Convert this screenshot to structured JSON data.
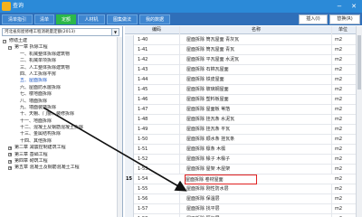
{
  "window": {
    "title": "查询",
    "minimize": "−",
    "close": "✕"
  },
  "tabs": [
    {
      "label": "清单指引"
    },
    {
      "label": "清单"
    },
    {
      "label": "定额"
    },
    {
      "label": "人材机"
    },
    {
      "label": "图集做法"
    },
    {
      "label": "我的数据"
    }
  ],
  "toolbar": {
    "insert_label": "插入(I)",
    "replace_label": "替换(R)"
  },
  "left": {
    "quota_library": "河北省房屋修缮工程消耗量定额(2013)",
    "tree": [
      {
        "label": "修缮土建",
        "level": 0,
        "toggle": "−"
      },
      {
        "label": "第一章  拆除工程",
        "level": 1,
        "toggle": "−"
      },
      {
        "label": "一、机械整体拆除建筑物",
        "level": 2,
        "toggle": ""
      },
      {
        "label": "二、机械单项拆除",
        "level": 2,
        "toggle": ""
      },
      {
        "label": "三、人工整体拆除建筑物",
        "level": 2,
        "toggle": ""
      },
      {
        "label": "四、人工拆除平房",
        "level": 2,
        "toggle": ""
      },
      {
        "label": "五、屋面拆除",
        "level": 2,
        "toggle": "",
        "selected": true
      },
      {
        "label": "六、屋面防水層拆除",
        "level": 2,
        "toggle": ""
      },
      {
        "label": "七、楼地面拆除",
        "level": 2,
        "toggle": ""
      },
      {
        "label": "八、墙面拆除",
        "level": 2,
        "toggle": ""
      },
      {
        "label": "九、墙面装饰拆除",
        "level": 2,
        "toggle": ""
      },
      {
        "label": "十、天棚、门窗、装修拆除",
        "level": 2,
        "toggle": ""
      },
      {
        "label": "十一、地面拆除",
        "level": 2,
        "toggle": ""
      },
      {
        "label": "十二、混凝土及钢筋混凝土拆除",
        "level": 2,
        "toggle": ""
      },
      {
        "label": "十三、金属结构拆除",
        "level": 2,
        "toggle": ""
      },
      {
        "label": "十四、其他拆除",
        "level": 2,
        "toggle": ""
      },
      {
        "label": "第二章  减震控制建筑工程",
        "level": 1,
        "toggle": "+"
      },
      {
        "label": "第三章  基础工程",
        "level": 1,
        "toggle": "+"
      },
      {
        "label": "第四章  砌筑工程",
        "level": 1,
        "toggle": "+"
      },
      {
        "label": "第五章  混凝土及钢筋混凝土工程",
        "level": 1,
        "toggle": "+"
      }
    ]
  },
  "grid": {
    "headers": {
      "code": "编码",
      "name": "名称",
      "unit": "单位"
    },
    "rows": [
      {
        "idx": "",
        "code": "1-40",
        "name": "屋面拆除  筒瓦屋面 青灰瓦",
        "unit": "m2"
      },
      {
        "idx": "",
        "code": "1-41",
        "name": "屋面拆除  筒瓦屋面 青瓦",
        "unit": "m2"
      },
      {
        "idx": "",
        "code": "1-42",
        "name": "屋面拆除  平瓦屋面 水泥瓦",
        "unit": "m2"
      },
      {
        "idx": "",
        "code": "1-43",
        "name": "屋面拆除  石棉瓦屋面",
        "unit": "m2"
      },
      {
        "idx": "",
        "code": "1-44",
        "name": "屋面拆除  铁皮屋面",
        "unit": "m2"
      },
      {
        "idx": "",
        "code": "1-45",
        "name": "屋面拆除  玻璃钢屋面",
        "unit": "m2"
      },
      {
        "idx": "",
        "code": "1-46",
        "name": "屋面拆除  塑料板屋面",
        "unit": "m2"
      },
      {
        "idx": "",
        "code": "1-47",
        "name": "屋面拆除  屋面板 苇箔",
        "unit": "m2"
      },
      {
        "idx": "",
        "code": "1-48",
        "name": "屋面拆除  挂瓦条 水泥瓦",
        "unit": "m2"
      },
      {
        "idx": "",
        "code": "1-49",
        "name": "屋面拆除  挂瓦条 平瓦",
        "unit": "m2"
      },
      {
        "idx": "",
        "code": "1-50",
        "name": "屋面拆除  顺水条 挂瓦条",
        "unit": "m2"
      },
      {
        "idx": "",
        "code": "1-51",
        "name": "屋面拆除  檩条 木檩",
        "unit": "m2"
      },
      {
        "idx": "",
        "code": "1-52",
        "name": "屋面拆除  椽子 木椽子",
        "unit": "m2"
      },
      {
        "idx": "",
        "code": "1-53",
        "name": "屋面拆除  屋架 木屋架",
        "unit": "m2"
      },
      {
        "idx": "15",
        "code": "1-54",
        "name": "屋面拆除  卷材屋面",
        "unit": "m2",
        "highlight": true
      },
      {
        "idx": "",
        "code": "1-55",
        "name": "屋面拆除  刚性防水层",
        "unit": "m2"
      },
      {
        "idx": "",
        "code": "1-56",
        "name": "屋面拆除  保温层",
        "unit": "m2"
      },
      {
        "idx": "",
        "code": "1-57",
        "name": "屋面拆除  找平层",
        "unit": "m2"
      },
      {
        "idx": "",
        "code": "1-58",
        "name": "屋面拆除  隔气层",
        "unit": "m2"
      }
    ]
  },
  "colors": {
    "titlebar": "#2b8ad8",
    "tabbar": "#2f6fb9",
    "active_tab": "#2cb84a",
    "arrow": "#111111"
  }
}
